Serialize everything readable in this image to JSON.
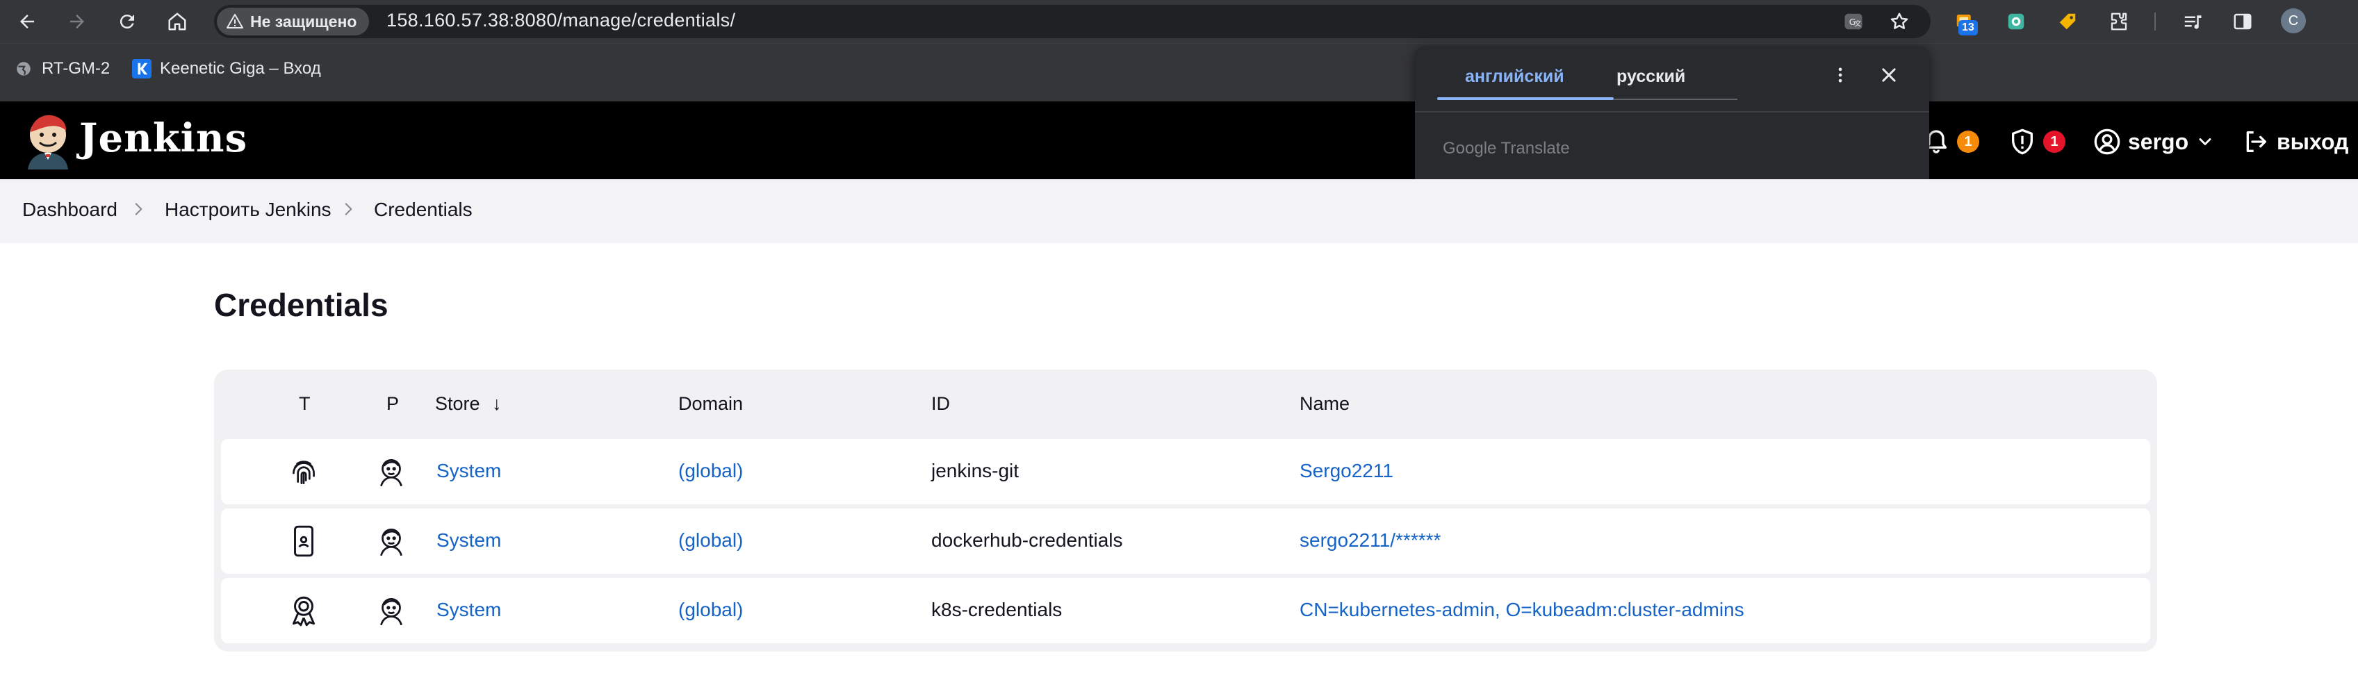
{
  "browser": {
    "security_label": "Не защищено",
    "url": "158.160.57.38:8080/manage/credentials/",
    "extension_badge": "13",
    "profile_initial": "C"
  },
  "bookmarks": [
    {
      "label": "RT-GM-2"
    },
    {
      "label": "Keenetic Giga – Вход"
    }
  ],
  "translate": {
    "tab_source": "английский",
    "tab_target": "русский",
    "brand": "Google Translate"
  },
  "header": {
    "title": "Jenkins",
    "notifications_count": "1",
    "security_count": "1",
    "user": "sergo",
    "logout": "выход"
  },
  "breadcrumb": [
    "Dashboard",
    "Настроить Jenkins",
    "Credentials"
  ],
  "page": {
    "title": "Credentials"
  },
  "table": {
    "columns": [
      "T",
      "P",
      "Store",
      "Domain",
      "ID",
      "Name"
    ],
    "sort_indicator": "↓",
    "rows": [
      {
        "type_icon": "fingerprint-icon",
        "store": "System",
        "domain": "(global)",
        "id": "jenkins-git",
        "name": "Sergo2211"
      },
      {
        "type_icon": "mobile-device-icon",
        "store": "System",
        "domain": "(global)",
        "id": "dockerhub-credentials",
        "name": "sergo2211/******"
      },
      {
        "type_icon": "certificate-icon",
        "store": "System",
        "domain": "(global)",
        "id": "k8s-credentials",
        "name": "CN=kubernetes-admin, O=kubeadm:cluster-admins"
      }
    ]
  },
  "colors": {
    "link": "#1663c7",
    "header_bg": "#000000",
    "badge_orange": "#f58a0b",
    "badge_red": "#e5142a",
    "translate_accent": "#8ab4f8"
  }
}
